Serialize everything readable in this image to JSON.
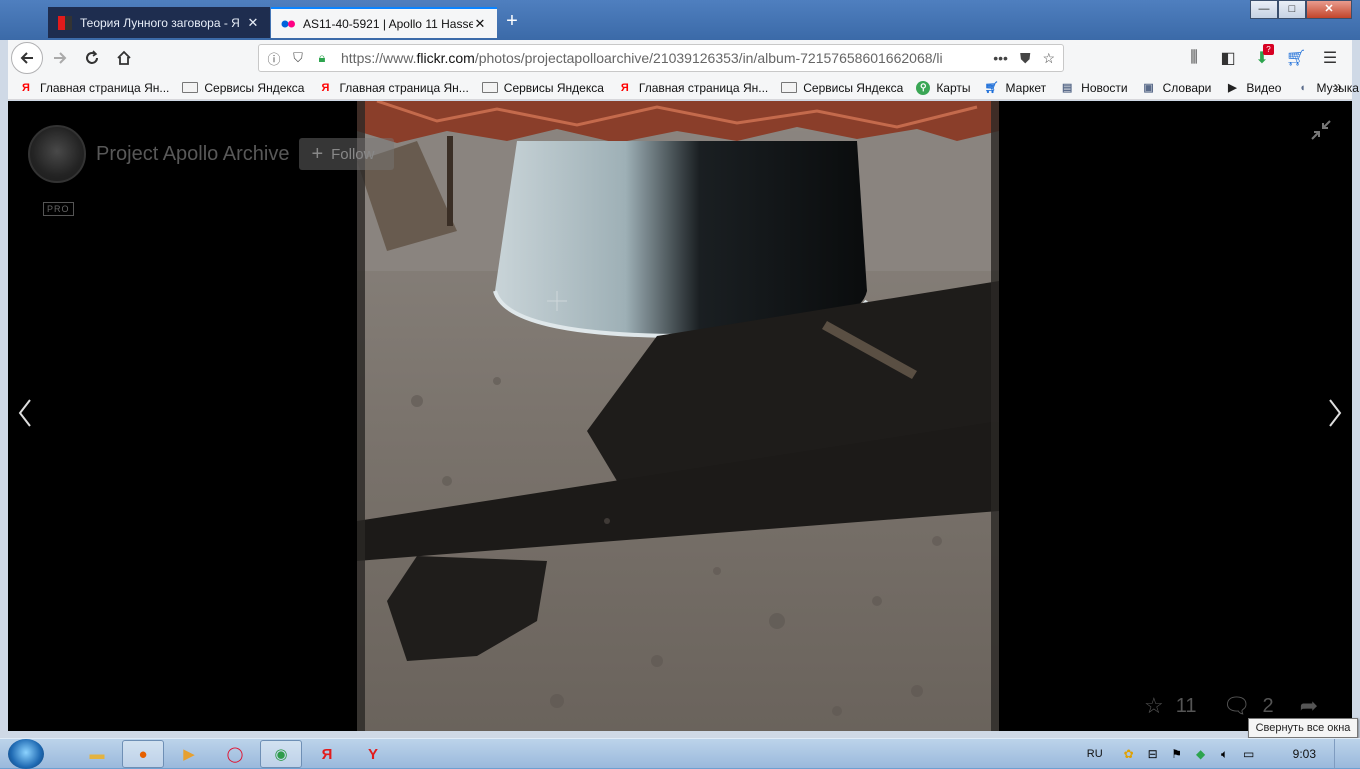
{
  "tabs": [
    {
      "title": "Теория Лунного заговора - Я",
      "active": false
    },
    {
      "title": "AS11-40-5921 | Apollo 11 Hasse",
      "active": true
    }
  ],
  "window_controls": {
    "minimize": "—",
    "maximize": "□",
    "close": "✕"
  },
  "navbar": {
    "url_prefix": "https://www.",
    "url_domain": "flickr.com",
    "url_rest": "/photos/projectapolloarchive/21039126353/in/album-72157658601662068/li",
    "downloads_badge": "?"
  },
  "bookmarks": [
    {
      "label": "Главная страница Ян...",
      "icon": "yandex-icon"
    },
    {
      "label": "Сервисы Яндекса",
      "icon": "folder-icon"
    },
    {
      "label": "Главная страница Ян...",
      "icon": "yandex-icon"
    },
    {
      "label": "Сервисы Яндекса",
      "icon": "folder-icon"
    },
    {
      "label": "Главная страница Ян...",
      "icon": "yandex-icon"
    },
    {
      "label": "Сервисы Яндекса",
      "icon": "folder-icon"
    },
    {
      "label": "Карты",
      "icon": "maps-icon"
    },
    {
      "label": "Маркет",
      "icon": "cart-icon"
    },
    {
      "label": "Новости",
      "icon": "news-icon"
    },
    {
      "label": "Словари",
      "icon": "dictionary-icon"
    },
    {
      "label": "Видео",
      "icon": "video-icon"
    },
    {
      "label": "Музыка",
      "icon": "music-icon"
    }
  ],
  "photo_page": {
    "owner_name": "Project Apollo Archive",
    "follow_label": "Follow",
    "pro_badge": "PRO",
    "favorites_count": "11",
    "comments_count": "2"
  },
  "tooltip": "Свернуть все окна",
  "taskbar": {
    "language": "RU",
    "clock": "9:03"
  }
}
